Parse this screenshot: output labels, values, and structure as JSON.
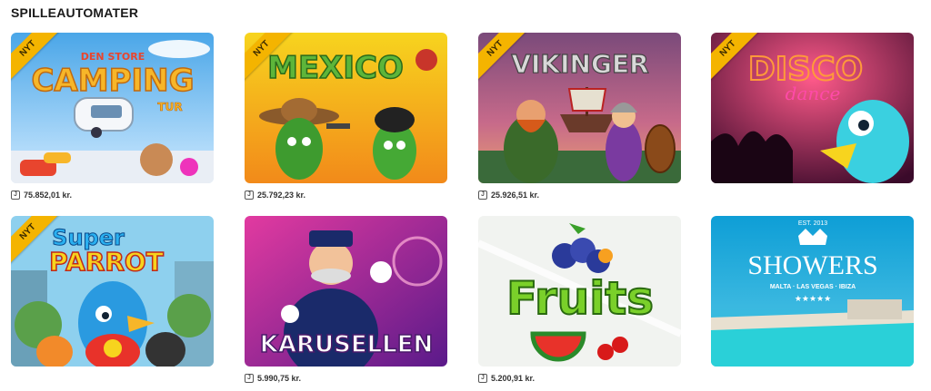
{
  "section": {
    "title": "SPILLEAUTOMATER"
  },
  "games": [
    {
      "title_main": "CAMPING",
      "title_top": "DEN STORE",
      "title_sub": "TUR",
      "badge": "NYT",
      "jackpot": "75.852,01 kr."
    },
    {
      "title_main": "MEXICO",
      "badge": "NYT",
      "jackpot": "25.792,23 kr."
    },
    {
      "title_main": "VIKINGER",
      "badge": "NYT",
      "jackpot": "25.926,51 kr."
    },
    {
      "title_main": "DISCO",
      "title_sub": "dance",
      "badge": "NYT",
      "jackpot": ""
    },
    {
      "title_top": "Super",
      "title_main": "PARROT",
      "badge": "NYT",
      "jackpot": ""
    },
    {
      "title_main": "KARUSELLEN",
      "badge": "",
      "jackpot": "5.990,75 kr."
    },
    {
      "title_main": "Fruits",
      "badge": "",
      "jackpot": "5.200,91 kr."
    },
    {
      "title_top": "EST. 2013",
      "title_main": "SHOWERS",
      "title_sub": "MALTA · LAS VEGAS · IBIZA",
      "stars": "★★★★★",
      "badge": "",
      "jackpot": ""
    }
  ],
  "jackpot_icon": "J",
  "colors": {
    "badge": "#f4b400",
    "text": "#222222"
  }
}
